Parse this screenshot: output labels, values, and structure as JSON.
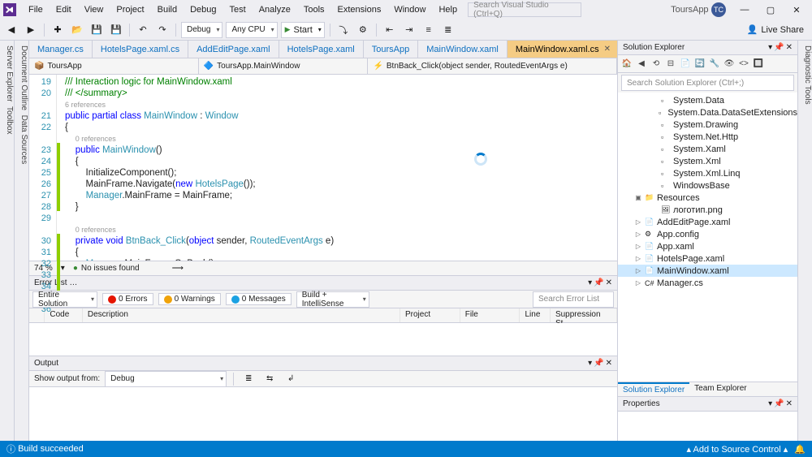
{
  "menu": [
    "File",
    "Edit",
    "View",
    "Project",
    "Build",
    "Debug",
    "Test",
    "Analyze",
    "Tools",
    "Extensions",
    "Window",
    "Help"
  ],
  "search_placeholder": "Search Visual Studio (Ctrl+Q)",
  "app_title": "ToursApp",
  "user_initials": "ТС",
  "toolbar": {
    "config": "Debug",
    "platform": "Any CPU",
    "start": "Start",
    "live_share": "Live Share"
  },
  "left_rail": [
    "Server Explorer",
    "Toolbox"
  ],
  "right_rail_top": "Diagnostic Tools",
  "left_rail2": [
    "Document Outline",
    "Data Sources"
  ],
  "doc_tabs": [
    {
      "label": "Manager.cs",
      "active": false
    },
    {
      "label": "HotelsPage.xaml.cs",
      "active": false
    },
    {
      "label": "AddEditPage.xaml",
      "active": false
    },
    {
      "label": "HotelsPage.xaml",
      "active": false
    },
    {
      "label": "ToursApp",
      "active": false
    },
    {
      "label": "MainWindow.xaml",
      "active": false
    },
    {
      "label": "MainWindow.xaml.cs",
      "active": true
    }
  ],
  "nav": {
    "a": "ToursApp",
    "b": "ToursApp.MainWindow",
    "c": "BtnBack_Click(object sender, RoutedEventArgs e)"
  },
  "lines_start": 19,
  "lines_end": 36,
  "code_lines": [
    {
      "n": 19,
      "h": "<span class='cm'>/// Interaction logic for MainWindow.xaml</span>"
    },
    {
      "n": 20,
      "h": "<span class='cm'>/// &lt;/summary&gt;</span>"
    },
    {
      "n": "",
      "h": "<span class='ref'>6 references</span>"
    },
    {
      "n": 21,
      "h": "<span class='kw'>public partial class</span> <span class='type'>MainWindow</span> : <span class='type'>Window</span>"
    },
    {
      "n": 22,
      "h": "{"
    },
    {
      "n": "",
      "h": "    <span class='ref'>0 references</span>"
    },
    {
      "n": 23,
      "h": "    <span class='kw'>public</span> <span class='type'>MainWindow</span>()",
      "g": true
    },
    {
      "n": 24,
      "h": "    {",
      "g": true
    },
    {
      "n": 25,
      "h": "        InitializeComponent();",
      "g": true
    },
    {
      "n": 26,
      "h": "        MainFrame.Navigate(<span class='kw'>new</span> <span class='type'>HotelsPage</span>());",
      "g": true
    },
    {
      "n": 27,
      "h": "        <span class='type'>Manager</span>.MainFrame = MainFrame;",
      "g": true
    },
    {
      "n": 28,
      "h": "    }",
      "g": true
    },
    {
      "n": 29,
      "h": ""
    },
    {
      "n": "",
      "h": "    <span class='ref'>0 references</span>"
    },
    {
      "n": 30,
      "h": "    <span class='kw'>private void</span> <span class='type'>BtnBack_Click</span>(<span class='kw'>object</span> sender, <span class='type'>RoutedEventArgs</span> e)",
      "g": true
    },
    {
      "n": 31,
      "h": "    {",
      "g": true
    },
    {
      "n": 32,
      "h": "        <span class='type'>Manager</span>.MainFrame.GoBack();",
      "g": true
    },
    {
      "n": 33,
      "h": "    }",
      "g": true
    },
    {
      "n": 34,
      "h": "}",
      "g": true
    },
    {
      "n": 35,
      "h": ""
    },
    {
      "n": 36,
      "h": ""
    }
  ],
  "editor_status": {
    "zoom": "74 %",
    "issues": "No issues found"
  },
  "error_list": {
    "title": "Error List",
    "scope": "Entire Solution",
    "errors": "0 Errors",
    "warnings": "0 Warnings",
    "messages": "0 Messages",
    "build": "Build + IntelliSense",
    "search": "Search Error List",
    "cols": [
      "",
      "Code",
      "Description",
      "Project",
      "File",
      "Line",
      "Suppression St..."
    ]
  },
  "output": {
    "title": "Output",
    "from_label": "Show output from:",
    "from": "Debug"
  },
  "solution": {
    "title": "Solution Explorer",
    "search": "Search Solution Explorer (Ctrl+;)",
    "tree": [
      {
        "d": 4,
        "ic": "▫",
        "label": "System.Data"
      },
      {
        "d": 4,
        "ic": "▫",
        "label": "System.Data.DataSetExtensions"
      },
      {
        "d": 4,
        "ic": "▫",
        "label": "System.Drawing"
      },
      {
        "d": 4,
        "ic": "▫",
        "label": "System.Net.Http"
      },
      {
        "d": 4,
        "ic": "▫",
        "label": "System.Xaml"
      },
      {
        "d": 4,
        "ic": "▫",
        "label": "System.Xml"
      },
      {
        "d": 4,
        "ic": "▫",
        "label": "System.Xml.Linq"
      },
      {
        "d": 4,
        "ic": "▫",
        "label": "WindowsBase"
      },
      {
        "d": 2,
        "exp": "▣",
        "ic": "📁",
        "label": "Resources"
      },
      {
        "d": 4,
        "ic": "🖼",
        "label": "логотип.png"
      },
      {
        "d": 2,
        "exp": "▷",
        "ic": "📄",
        "label": "AddEditPage.xaml"
      },
      {
        "d": 2,
        "exp": "▷",
        "ic": "⚙",
        "label": "App.config"
      },
      {
        "d": 2,
        "exp": "▷",
        "ic": "📄",
        "label": "App.xaml"
      },
      {
        "d": 2,
        "exp": "▷",
        "ic": "📄",
        "label": "HotelsPage.xaml"
      },
      {
        "d": 2,
        "exp": "▷",
        "ic": "📄",
        "label": "MainWindow.xaml",
        "sel": true
      },
      {
        "d": 2,
        "exp": "▷",
        "ic": "C#",
        "label": "Manager.cs"
      }
    ],
    "tabs": [
      "Solution Explorer",
      "Team Explorer"
    ]
  },
  "properties": {
    "title": "Properties"
  },
  "status": {
    "left": "Build succeeded",
    "right": "Add to Source Control"
  }
}
